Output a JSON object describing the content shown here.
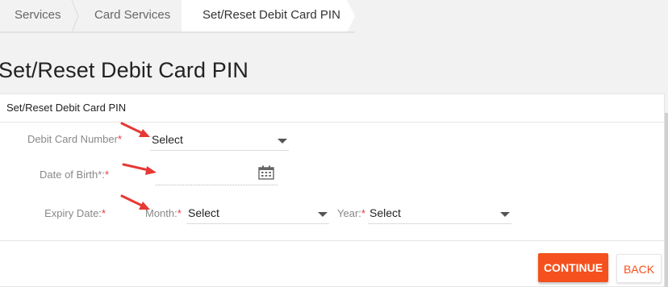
{
  "breadcrumb": {
    "items": [
      "Services",
      "Card Services",
      "Set/Reset Debit Card PIN"
    ]
  },
  "page_title": "Set/Reset Debit Card PIN",
  "panel": {
    "header": "Set/Reset Debit Card PIN"
  },
  "form": {
    "debit_card": {
      "label": "Debit Card Number",
      "required": "*",
      "value": "Select"
    },
    "dob": {
      "label": "Date of Birth*:",
      "required": "*",
      "value": ""
    },
    "expiry": {
      "label": "Expiry Date:",
      "required": "*",
      "month_label": "Month:",
      "month_required": "*",
      "month_value": "Select",
      "year_label": "Year:",
      "year_required": "*",
      "year_value": "Select"
    }
  },
  "buttons": {
    "continue": "CONTINUE",
    "back": "BACK"
  },
  "colors": {
    "accent": "#f4511e",
    "required": "#e53935",
    "annotation_arrow": "#e53935"
  },
  "icons": [
    "calendar-icon",
    "chevron-down-icon",
    "annotation-arrow"
  ]
}
